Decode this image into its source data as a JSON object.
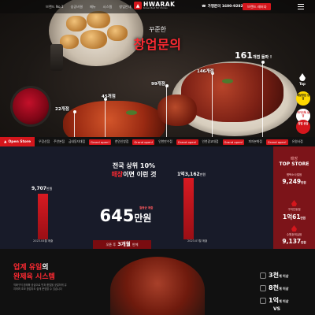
{
  "nav": {
    "menu": [
      "브랜드 No.1",
      "성공비결",
      "메뉴",
      "시스템",
      "창업안내"
    ],
    "logo_name": "HWARAK",
    "logo_sub": "Korean Best Hot Chicken",
    "phone": "가맹문의 1600-9282",
    "brand_button": "브랜드 레터다"
  },
  "hero": {
    "subtitle": "꾸준한",
    "title": "창업문의",
    "bars": [
      {
        "label": "22개점"
      },
      {
        "label": "45개점"
      },
      {
        "label": "99개점"
      },
      {
        "label": "146개점"
      }
    ],
    "big_count": "161",
    "big_count_suffix": "개점 돌파 !"
  },
  "floating": {
    "top_label": "Top",
    "chip1": "배달창업 상담",
    "chip2": "카카오톡 상담",
    "chip3": "창업 상담"
  },
  "marquee": {
    "label": "Open Store",
    "items": [
      "우장산점",
      "주안본점",
      "금내동자대점",
      "Grand open!",
      "천안신방점",
      "Grand open!",
      "인천만수점",
      "Grand open!",
      "인천광교대점",
      "Grand open!",
      "피자본화점",
      "Grand open!",
      "유원사점"
    ]
  },
  "stats": {
    "title_line1": "전국 상위 10%",
    "title_line2_prefix": "매장",
    "title_line2_suffix": "이면 이런 것",
    "left_value": "9,707",
    "left_unit": "만원",
    "right_value": "1억3,162",
    "right_unit": "만원",
    "center_value": "645",
    "center_unit": "만원",
    "center_caption": "월평균 매출",
    "date_left": "2023.04월 매출",
    "date_right": "2023.07월 매출",
    "period_label": "3개월",
    "period_prefix": "오픈 후",
    "period_suffix": "만에"
  },
  "chart_data": {
    "type": "bar",
    "categories": [
      "2023.04월 매출",
      "2023.07월 매출"
    ],
    "values": [
      9707,
      13162
    ],
    "ylabel": "만원"
  },
  "top_store": {
    "head": "매장",
    "title": "TOP STORE",
    "items": [
      {
        "name": "평택소사벌점",
        "value": "9,249",
        "unit": "만원"
      },
      {
        "name": "구미인동점",
        "value": "1억61",
        "unit": "만원"
      },
      {
        "name": "수원호매실점",
        "value": "9,137",
        "unit": "만원"
      }
    ]
  },
  "bottom": {
    "title1_prefix": "업계 유일",
    "title1_suffix": "의",
    "title2": "완제육 시스템",
    "desc": "직화구이 완제육 공급으로 맛과 품질을 균일하게 유지하며 초보 창업자도 쉽게 운영할 수 있습니다",
    "caps": [
      {
        "value": "3천",
        "unit": "개 이상"
      },
      {
        "value": "8천",
        "unit": "개 이상"
      },
      {
        "value": "1억",
        "unit": "개 이상"
      }
    ],
    "vs": "VS"
  }
}
